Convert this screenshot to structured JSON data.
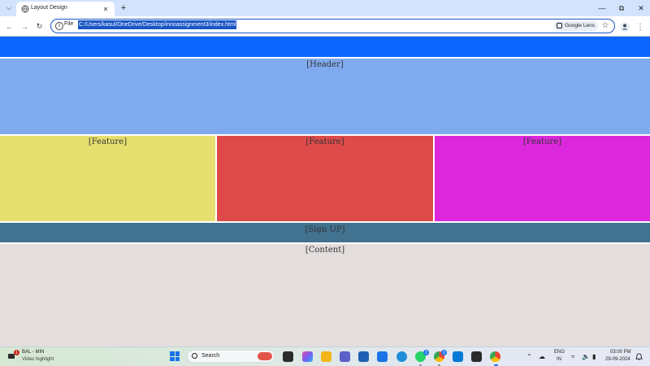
{
  "browser": {
    "tab": {
      "title": "Layout Design"
    },
    "address_bar": {
      "chip": "File",
      "url": "C:/Users/kasul/OneDrive/Desktop/innoassignment3/index.html"
    },
    "lens_label": "Google Lens"
  },
  "page": {
    "colors": {
      "top_bar": "#0a66ff",
      "header": "#7faaee",
      "feature_1": "#e6e070",
      "feature_2": "#de4a4a",
      "feature_3": "#dc28dc",
      "signup": "#41728f",
      "content": "#e3dedd"
    },
    "header_label": "[Header]",
    "features": [
      {
        "label": "[Feature]"
      },
      {
        "label": "[Feature]"
      },
      {
        "label": "[Feature]"
      }
    ],
    "signup_label": "[Sign UP]",
    "content_label": "[Content]"
  },
  "taskbar": {
    "widget": {
      "badge": "1",
      "title": "BAL - MIN",
      "subtitle": "Video highlight"
    },
    "search_placeholder": "Search",
    "badges": {
      "whatsapp": "2",
      "chrome_profile": "2"
    },
    "language": {
      "line1": "ENG",
      "line2": "IN"
    },
    "clock": {
      "time": "03:00 PM",
      "date": "29-09-2024"
    }
  }
}
